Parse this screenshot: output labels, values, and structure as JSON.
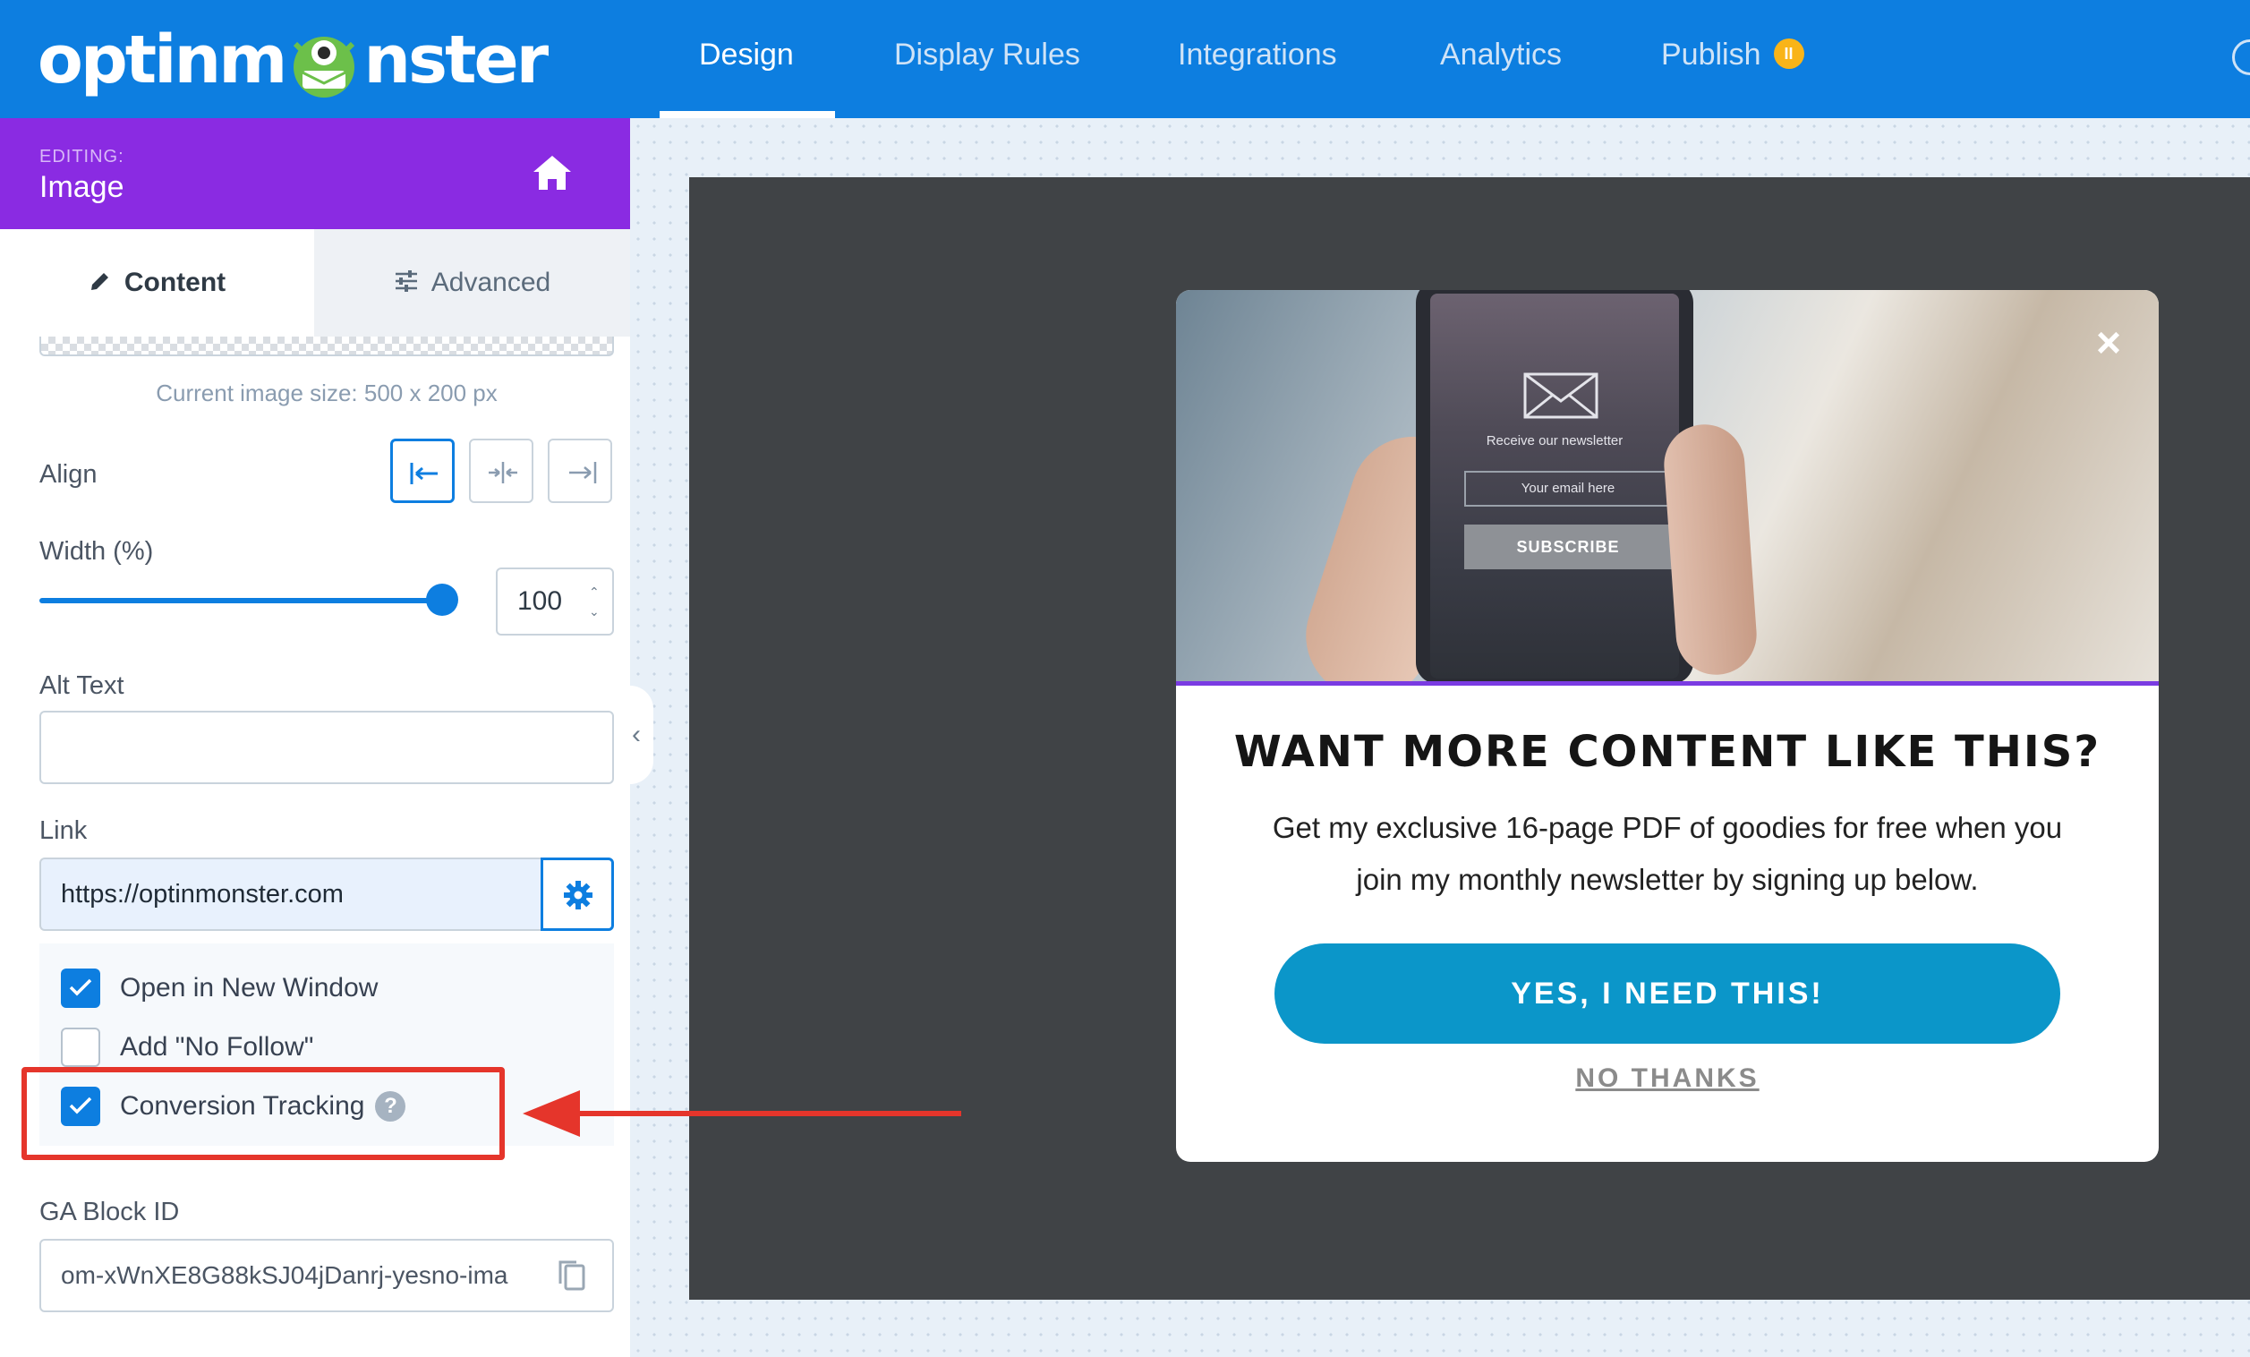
{
  "app": {
    "logo_text_left": "optinm",
    "logo_text_right": "nster"
  },
  "nav": {
    "items": [
      {
        "label": "Design",
        "active": true
      },
      {
        "label": "Display Rules"
      },
      {
        "label": "Integrations"
      },
      {
        "label": "Analytics"
      },
      {
        "label": "Publish"
      }
    ],
    "publish_badge": "II"
  },
  "editing": {
    "label": "EDITING:",
    "title": "Image"
  },
  "tabs": {
    "content": "Content",
    "advanced": "Advanced"
  },
  "image": {
    "size_text": "Current image size: 500 x 200 px"
  },
  "align": {
    "label": "Align"
  },
  "width": {
    "label": "Width (%)",
    "value": "100",
    "percent": 100
  },
  "alt": {
    "label": "Alt Text",
    "value": ""
  },
  "link": {
    "label": "Link",
    "value": "https://optinmonster.com"
  },
  "checks": {
    "new_window": {
      "label": "Open in New Window",
      "checked": true
    },
    "no_follow": {
      "label": "Add \"No Follow\"",
      "checked": false
    },
    "conversion": {
      "label": "Conversion Tracking",
      "checked": true,
      "help": "?"
    }
  },
  "ga": {
    "label": "GA Block ID",
    "value": "om-xWnXE8G88kSJ04jDanrj-yesno-ima"
  },
  "popup": {
    "phone_caption": "Receive our newsletter",
    "phone_input": "Your email here",
    "phone_button": "SUBSCRIBE",
    "close": "×",
    "headline": "WANT MORE CONTENT LIKE THIS?",
    "body_line1": "Get my exclusive 16-page PDF of goodies for free when you",
    "body_line2": "join my monthly newsletter by signing up below.",
    "cta": "YES, I NEED THIS!",
    "decline": "NO THANKS"
  },
  "colors": {
    "nav": "#0d7ee0",
    "editing": "#8a2be2",
    "cta": "#0b96c9",
    "highlight": "#e5352b"
  }
}
